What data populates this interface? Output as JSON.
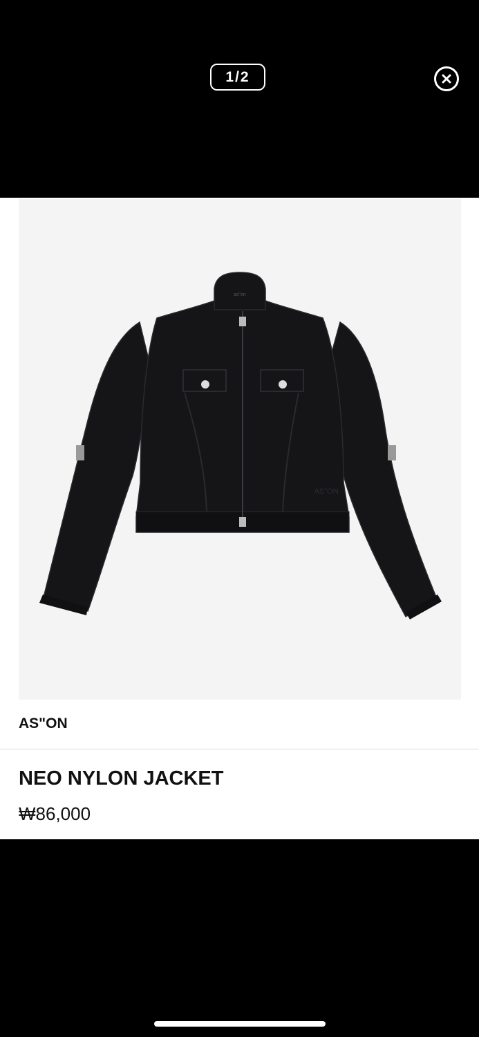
{
  "viewer": {
    "page_counter": "1/2"
  },
  "icons": {
    "close": "close-circle-icon"
  },
  "product": {
    "brand": "AS\"ON",
    "name": "NEO NYLON JACKET",
    "price": "₩86,000",
    "image_label": "as\"on",
    "image_embroidery": "AS\"ON"
  },
  "colors": {
    "background": "#000000",
    "card": "#ffffff",
    "image_bg": "#f4f4f4",
    "jacket": "#151518"
  }
}
